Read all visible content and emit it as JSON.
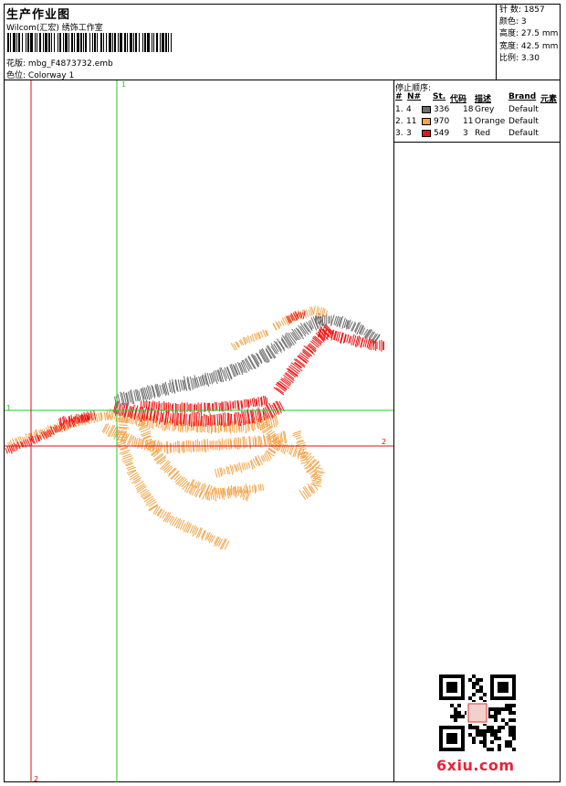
{
  "header": {
    "title": "生产作业图",
    "subtitle": "Wilcom(汇宏) 绣饰工作室",
    "file_label": "花版:",
    "file_value": "mbg_F4873732.emb",
    "colorway_label": "色位:",
    "colorway_value": "Colorway 1"
  },
  "stats": [
    {
      "label": "针 数:",
      "value": "1857"
    },
    {
      "label": "颜色:",
      "value": "3"
    },
    {
      "label": "高度:",
      "value": "27.5 mm"
    },
    {
      "label": "宽度:",
      "value": "42.5 mm"
    },
    {
      "label": "比例:",
      "value": "3.30"
    }
  ],
  "stop_sequence": {
    "title": "停止顺序:",
    "headers": [
      "#",
      "N#",
      "St.",
      "代码",
      "描述",
      "Brand",
      "元素"
    ],
    "rows": [
      {
        "num": "1.",
        "n": "4",
        "stitches": "336",
        "code": "18",
        "desc": "Grey",
        "brand": "Default",
        "color": "#6e6e6e"
      },
      {
        "num": "2.",
        "n": "11",
        "stitches": "970",
        "code": "11",
        "desc": "Orange",
        "brand": "Default",
        "color": "#f4a347"
      },
      {
        "num": "3.",
        "n": "3",
        "stitches": "549",
        "code": "3",
        "desc": "Red",
        "brand": "Default",
        "color": "#ee1111"
      }
    ]
  },
  "guides": {
    "v1_label": "1",
    "h1_label": "1",
    "h2_label": "2",
    "v2_label": "2"
  },
  "colors": {
    "guide_green": "#22cc22",
    "guide_red": "#dd1111",
    "grey_thread": "#6e6e6e",
    "orange_thread": "#f4a347",
    "red_thread": "#ee1111"
  },
  "watermark": "6xiu.com"
}
